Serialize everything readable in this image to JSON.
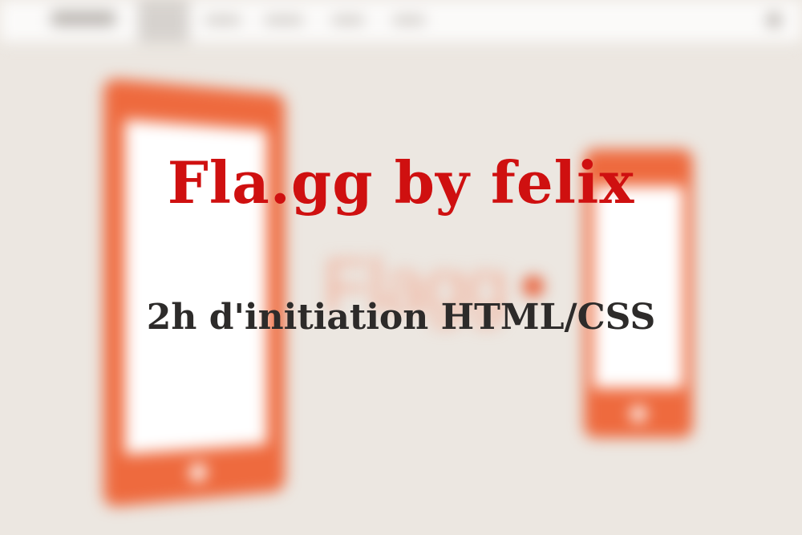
{
  "slide": {
    "title": "Fla.gg by felix",
    "subtitle": "2h d'initiation HTML/CSS"
  },
  "colors": {
    "title": "#cf1010",
    "subtitle": "#2d2b2a",
    "background": "#ece7e1",
    "device": "#ee6a3e"
  },
  "background_icons": [
    "tablet-icon",
    "phone-icon"
  ]
}
